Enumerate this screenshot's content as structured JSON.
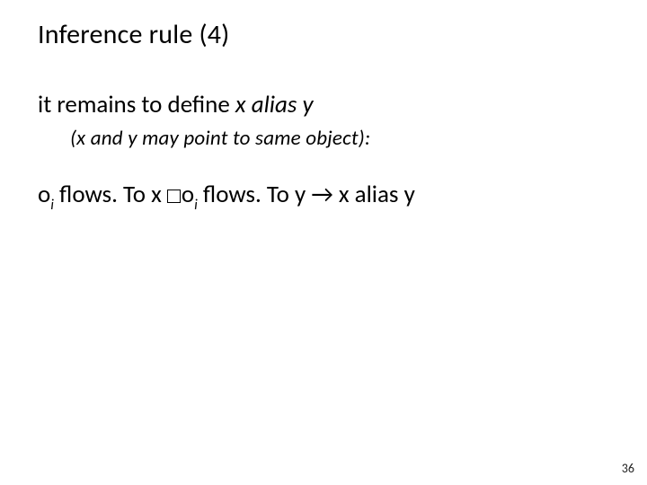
{
  "title": "Inference rule (4)",
  "line1": {
    "prefix": "it remains to define ",
    "x": "x",
    "mid": " alias ",
    "y": "y"
  },
  "line2": "(x and y may point to same object):",
  "rule": {
    "o1": "o",
    "sub1": "i",
    "flows1": "  flows. To  x  ",
    "o2": "o",
    "sub2": "i",
    "flows2": "  flows. To  y  →  x  alias  y"
  },
  "page": "36"
}
